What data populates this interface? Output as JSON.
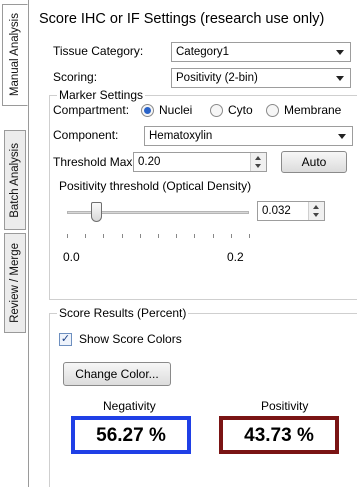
{
  "tabs": [
    {
      "label": "Manual Analysis",
      "active": true
    },
    {
      "label": "Batch Analysis",
      "active": false
    },
    {
      "label": "Review / Merge",
      "active": false
    }
  ],
  "title": "Score IHC or IF Settings (research use only)",
  "tissue_category": {
    "label": "Tissue Category:",
    "value": "Category1"
  },
  "scoring": {
    "label": "Scoring:",
    "value": "Positivity (2-bin)"
  },
  "marker_settings": {
    "group_title": "Marker Settings",
    "compartment": {
      "label": "Compartment:",
      "options": [
        "Nuclei",
        "Cyto",
        "Membrane"
      ],
      "selected": "Nuclei"
    },
    "component": {
      "label": "Component:",
      "value": "Hematoxylin"
    },
    "threshold_max": {
      "label": "Threshold Max:",
      "value": "0.20",
      "auto_label": "Auto"
    },
    "positivity_threshold": {
      "label": "Positivity threshold (Optical Density)",
      "value": "0.032",
      "min_label": "0.0",
      "max_label": "0.2",
      "slider_fraction": 0.16
    }
  },
  "score_results": {
    "group_title": "Score Results (Percent)",
    "show_colors_label": "Show Score Colors",
    "show_colors_checked": true,
    "change_color_label": "Change Color...",
    "negativity": {
      "label": "Negativity",
      "value": "56.27 %",
      "color": "#1f3fe6"
    },
    "positivity": {
      "label": "Positivity",
      "value": "43.73 %",
      "color": "#7a1414"
    }
  },
  "colors": {
    "radio_selected": "#2a63c8"
  }
}
